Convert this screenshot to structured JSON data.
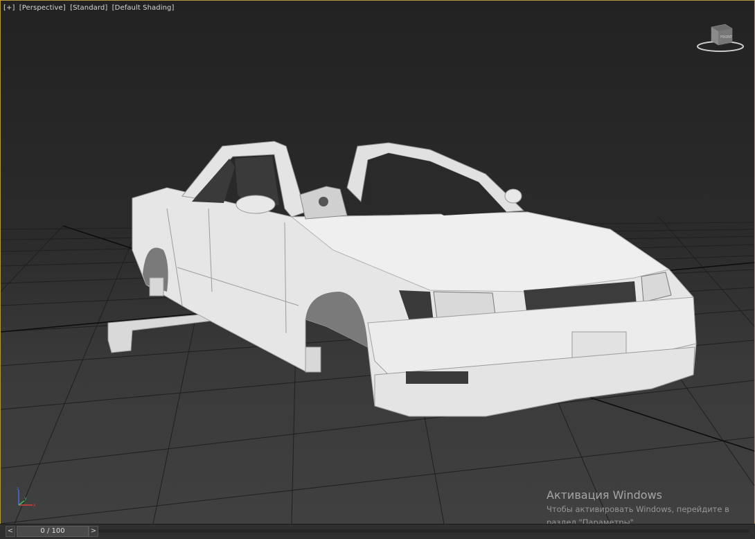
{
  "viewport": {
    "labels": [
      "[+]",
      "[Perspective]",
      "[Standard]",
      "[Default Shading]"
    ],
    "viewcube_face": "FRONT",
    "axis_labels": [
      "x",
      "y",
      "z"
    ]
  },
  "timeline": {
    "frame_display": "0 / 100",
    "prev_icon": "<",
    "next_icon": ">"
  },
  "watermark": {
    "title": "Активация Windows",
    "line1": "Чтобы активировать Windows, перейдите в",
    "line2": "раздел \"Параметры\"."
  },
  "colors": {
    "viewport_border": "#b59a3a",
    "car_body": "#e8e8e8",
    "grid": "#1a1a1a"
  }
}
